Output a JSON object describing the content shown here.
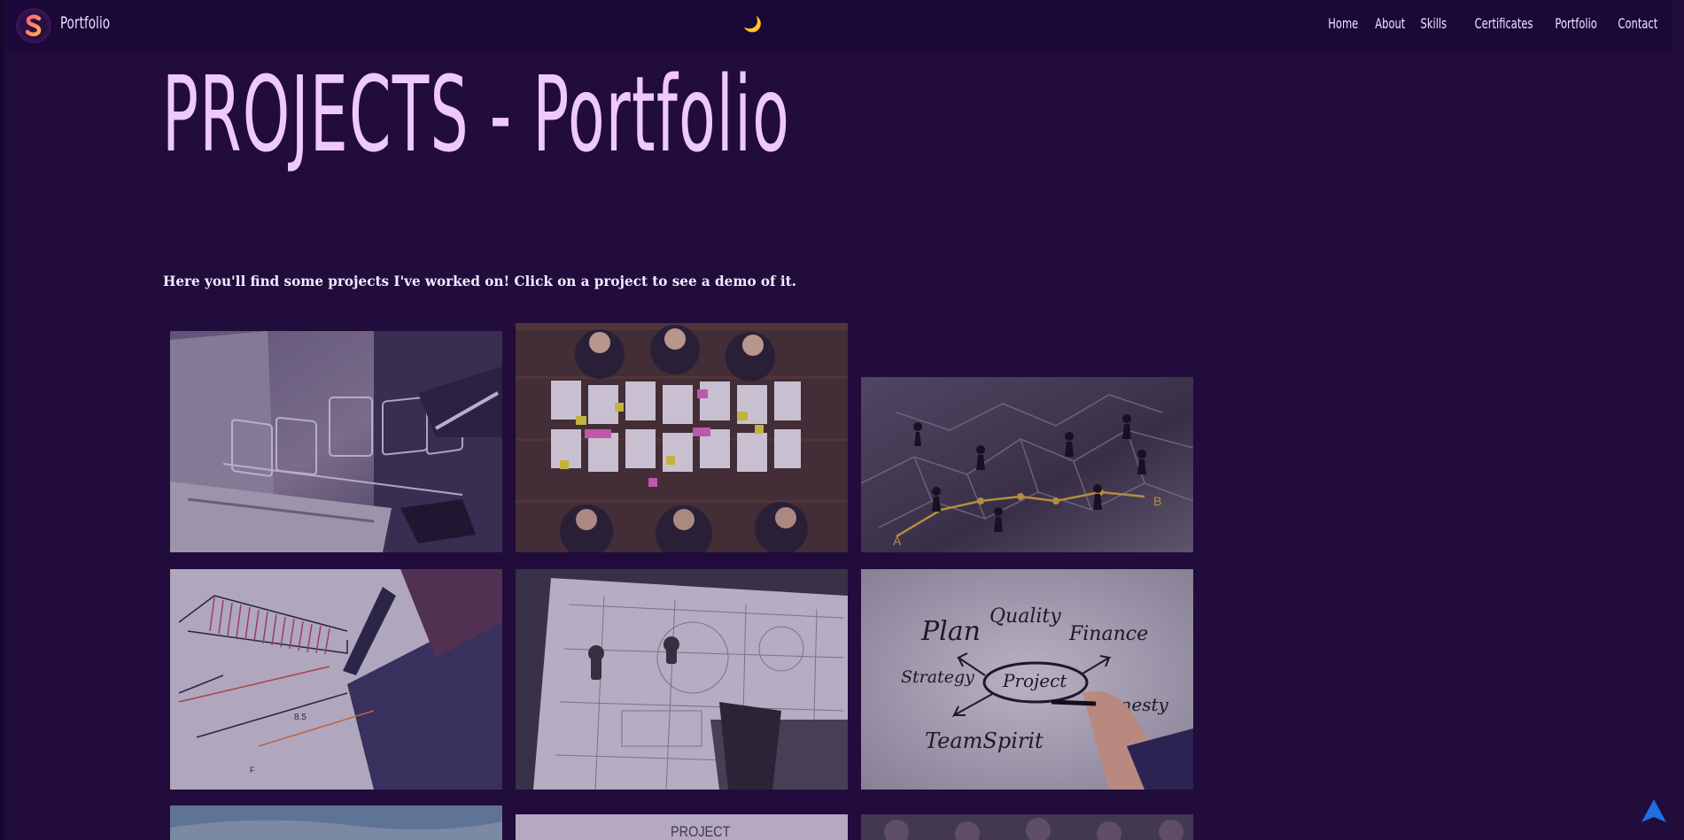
{
  "nav": {
    "brand": "Portfolio",
    "theme_toggle": "🌙",
    "links": [
      "Home",
      "About",
      "Skills",
      "Certificates",
      "Portfolio",
      "Contact"
    ]
  },
  "header": {
    "title": "PROJECTS - Portfolio",
    "intro": "Here you'll find some projects I've worked on! Click on a project to see a demo of it."
  },
  "projects": {
    "planning_words": [
      "Plan",
      "Quality",
      "Finance",
      "Strategy",
      "Project",
      "Honesty",
      "TeamSpirit"
    ],
    "partial_card_text": "PROJECT"
  },
  "icons": {
    "logo": "s-logo-icon",
    "theme": "moon-icon",
    "scroll": "arrow-up-icon"
  },
  "colors": {
    "background": "#210c3c",
    "navbar": "#1a0838",
    "title": "#efc8ff",
    "scroll_button": "#1f6fe0"
  }
}
